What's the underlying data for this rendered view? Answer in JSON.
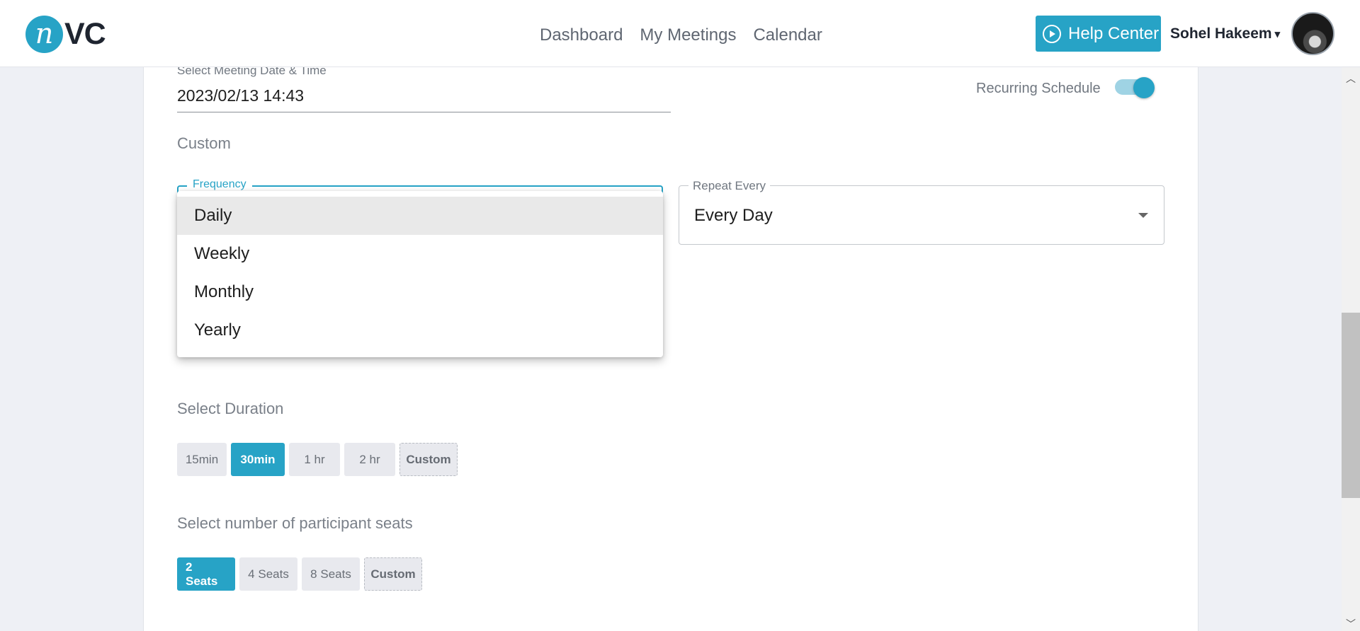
{
  "header": {
    "logo_mark": "n",
    "logo_text": "VC",
    "nav": [
      "Dashboard",
      "My Meetings",
      "Calendar"
    ],
    "help_label": "Help Center",
    "user_name": "Sohel Hakeem",
    "user_caret": "▾"
  },
  "form": {
    "date_label": "Select Meeting Date & Time",
    "date_value": "2023/02/13 14:43",
    "recurring_label": "Recurring Schedule",
    "recurring_on": true,
    "custom_heading": "Custom",
    "frequency_label": "Frequency",
    "frequency_options": [
      "Daily",
      "Weekly",
      "Monthly",
      "Yearly"
    ],
    "frequency_selected": "Daily",
    "repeat_label": "Repeat Every",
    "repeat_value": "Every Day",
    "duration_label": "Select Duration",
    "duration_options": [
      "15min",
      "30min",
      "1 hr",
      "2 hr",
      "Custom"
    ],
    "duration_selected": "30min",
    "seats_label": "Select number of participant seats",
    "seat_options": [
      "2 Seats",
      "4 Seats",
      "8 Seats",
      "Custom"
    ],
    "seats_selected": "2 Seats"
  },
  "colors": {
    "accent": "#27a3c6",
    "chip_bg": "#e8e9ee",
    "page_bg": "#eef0f5"
  },
  "icons": {
    "help": "play-circle-icon",
    "scroll_up": "chevron-up-icon",
    "scroll_down": "chevron-down-icon"
  }
}
